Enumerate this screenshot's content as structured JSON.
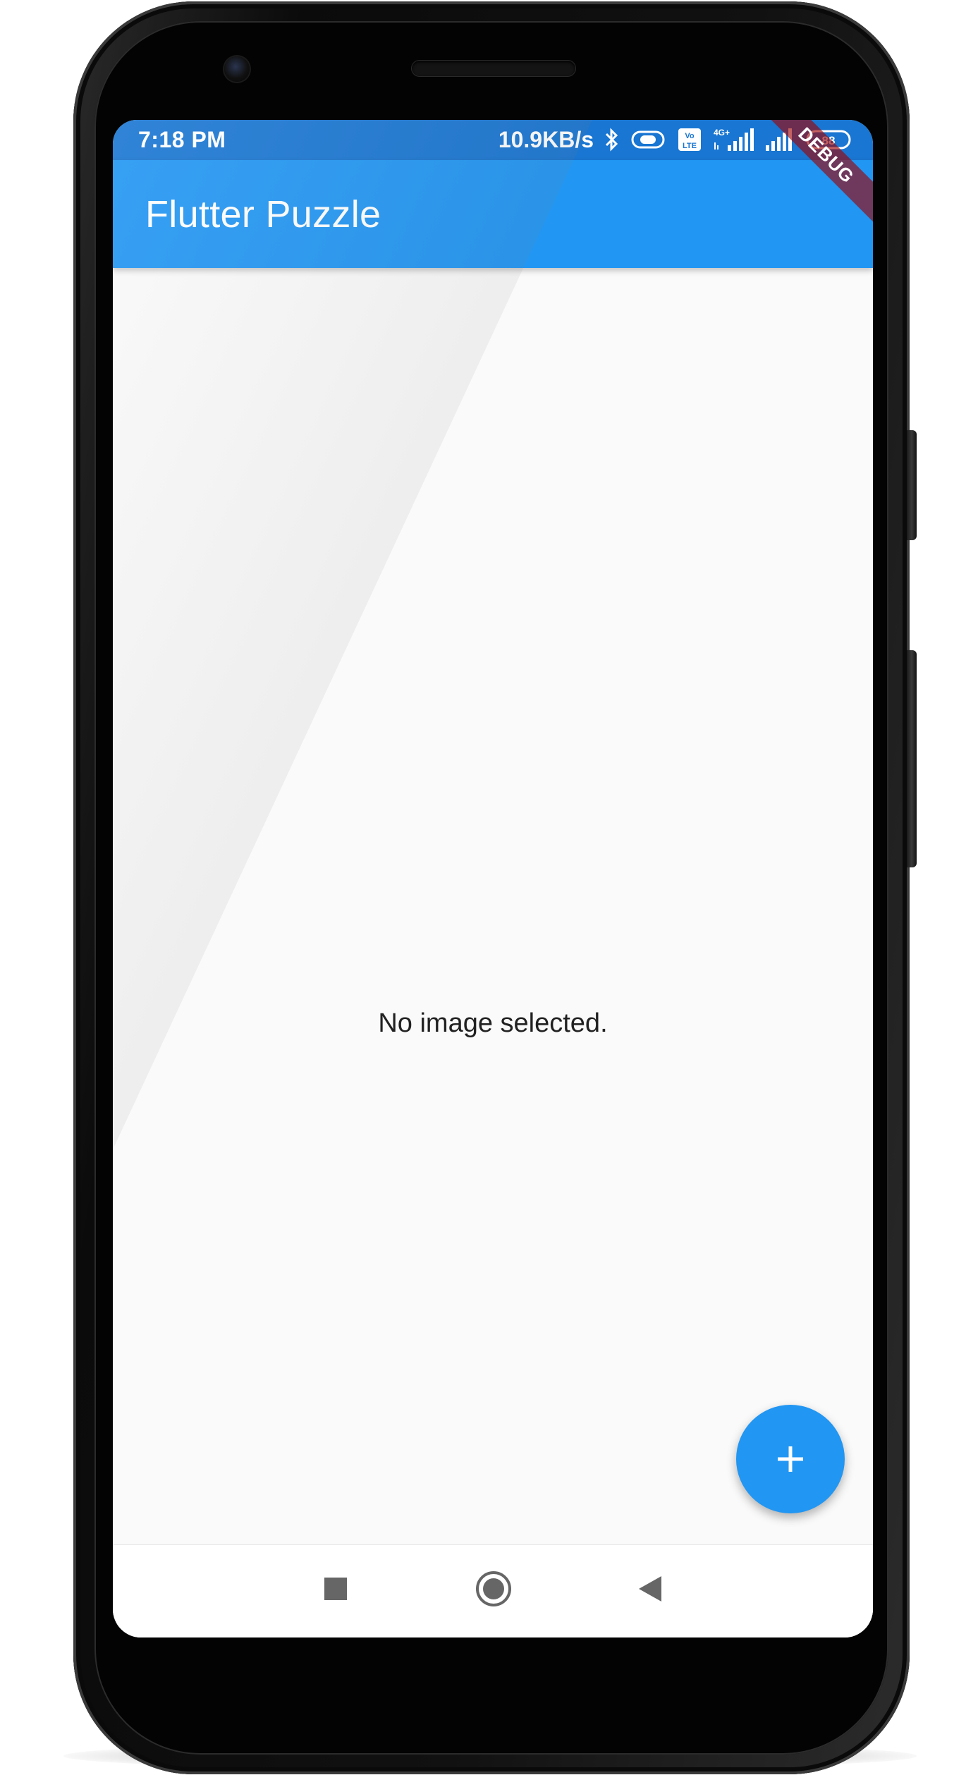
{
  "status_bar": {
    "time": "7:18 PM",
    "network_speed": "10.9KB/s",
    "battery_level": "88",
    "volte_label": "Vo LTE",
    "network_type": "4G+",
    "icons": [
      "bluetooth-icon",
      "toggle-icon",
      "volte-icon",
      "signal-4g-icon",
      "signal-icon",
      "battery-icon"
    ]
  },
  "app_bar": {
    "title": "Flutter Puzzle",
    "color": "#2196f3"
  },
  "debug_banner": {
    "label": "DEBUG"
  },
  "body": {
    "empty_message": "No image selected."
  },
  "fab": {
    "icon": "plus-icon",
    "color": "#2196f3"
  },
  "nav_bar": {
    "buttons": [
      "recent-apps-icon",
      "home-icon",
      "back-icon"
    ]
  }
}
